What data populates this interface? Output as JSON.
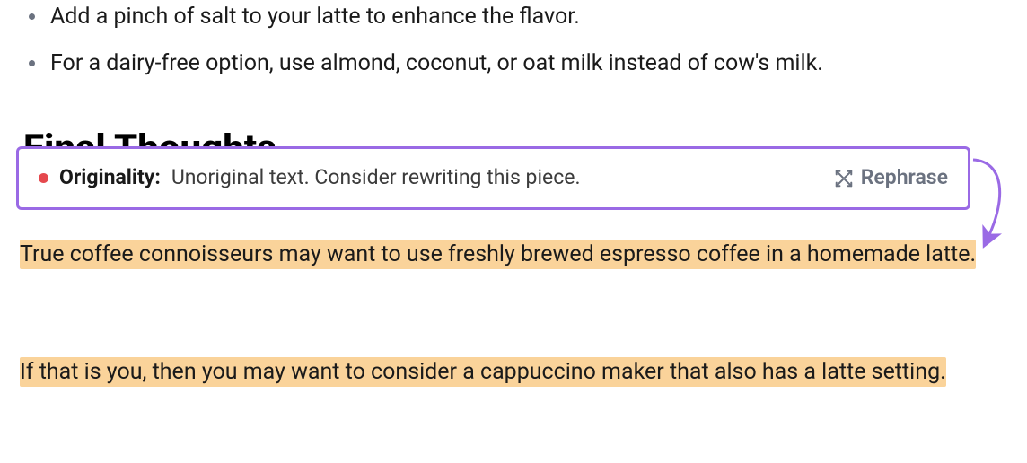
{
  "bullets": [
    "Add a pinch of salt to your latte to enhance the flavor.",
    "For a dairy-free option, use almond, coconut, or oat milk instead of cow's milk."
  ],
  "obscured_heading": "Final Thoughts",
  "originality_card": {
    "status_dot_color": "#e5484d",
    "label": "Originality:",
    "message": "Unoriginal text. Consider rewriting this piece.",
    "rephrase_label": "Rephrase",
    "border_color": "#9a6ae5"
  },
  "icons": {
    "rephrase": "rephrase-icon"
  },
  "highlighted": {
    "para1": "True coffee connoisseurs may want to use freshly brewed espresso coffee in a homemade latte.",
    "para2": "If that is you, then you may want to consider a cappuccino maker that also has a latte setting."
  },
  "highlight_color": "#fad39a"
}
